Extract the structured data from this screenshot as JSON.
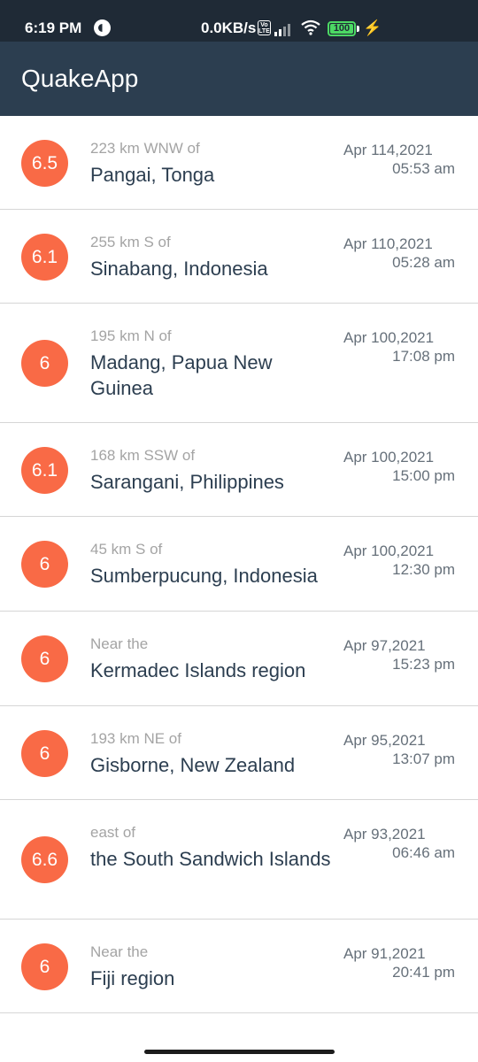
{
  "status_bar": {
    "time": "6:19 PM",
    "network_speed": "0.0KB/s",
    "volte": "Vo LTE",
    "battery": "100",
    "icons": [
      "dnd-icon",
      "volte-icon",
      "signal-icon",
      "wifi-icon",
      "battery-icon",
      "charging-icon"
    ]
  },
  "app_bar": {
    "title": "QuakeApp"
  },
  "colors": {
    "header": "#2c3e50",
    "status": "#1f2a36",
    "magnitude": "#f96a46",
    "place": "#2c3e50",
    "offset": "#a4a4a4",
    "date": "#66707a"
  },
  "quakes": [
    {
      "mag": "6.5",
      "offset": "223 km WNW of",
      "place": "Pangai, Tonga",
      "date": "Apr 114,2021",
      "time": "05:53 am"
    },
    {
      "mag": "6.1",
      "offset": "255 km S of",
      "place": "Sinabang, Indonesia",
      "date": "Apr 110,2021",
      "time": "05:28 am"
    },
    {
      "mag": "6",
      "offset": "195 km N of",
      "place": "Madang, Papua New Guinea",
      "date": "Apr 100,2021",
      "time": "17:08 pm"
    },
    {
      "mag": "6.1",
      "offset": "168 km SSW of",
      "place": "Sarangani, Philippines",
      "date": "Apr 100,2021",
      "time": "15:00 pm"
    },
    {
      "mag": "6",
      "offset": "45 km S of",
      "place": "Sumberpucung, Indonesia",
      "date": "Apr 100,2021",
      "time": "12:30 pm"
    },
    {
      "mag": "6",
      "offset": "Near the",
      "place": "Kermadec Islands region",
      "date": "Apr 97,2021",
      "time": "15:23 pm"
    },
    {
      "mag": "6",
      "offset": "193 km NE of",
      "place": "Gisborne, New Zealand",
      "date": "Apr 95,2021",
      "time": "13:07 pm"
    },
    {
      "mag": "6.6",
      "offset": "east of",
      "place": "the South Sandwich Islands",
      "date": "Apr 93,2021",
      "time": "06:46 am"
    },
    {
      "mag": "6",
      "offset": "Near the",
      "place": "Fiji region",
      "date": "Apr 91,2021",
      "time": "20:41 pm"
    }
  ]
}
